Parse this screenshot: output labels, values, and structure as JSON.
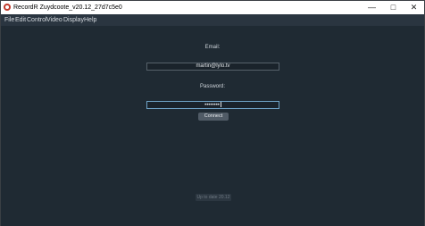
{
  "window": {
    "title": "RecordR Zuydcoote_v20.12_27d7c5e0",
    "minimize_icon": "minimize-icon",
    "maximize_icon": "maximize-icon",
    "close_icon": "close-icon",
    "accent": "#c0392b"
  },
  "menubar": {
    "items": [
      {
        "label": "File"
      },
      {
        "label": "Edit"
      },
      {
        "label": "Control"
      },
      {
        "label": "Video"
      },
      {
        "label": "Display"
      },
      {
        "label": "Help"
      }
    ]
  },
  "login": {
    "email_label": "Email:",
    "email_value": "martin@lylo.tv",
    "password_label": "Password:",
    "password_value": "••••••••",
    "connect_label": "Connect"
  },
  "status": {
    "text": "Up to date 20.12"
  }
}
